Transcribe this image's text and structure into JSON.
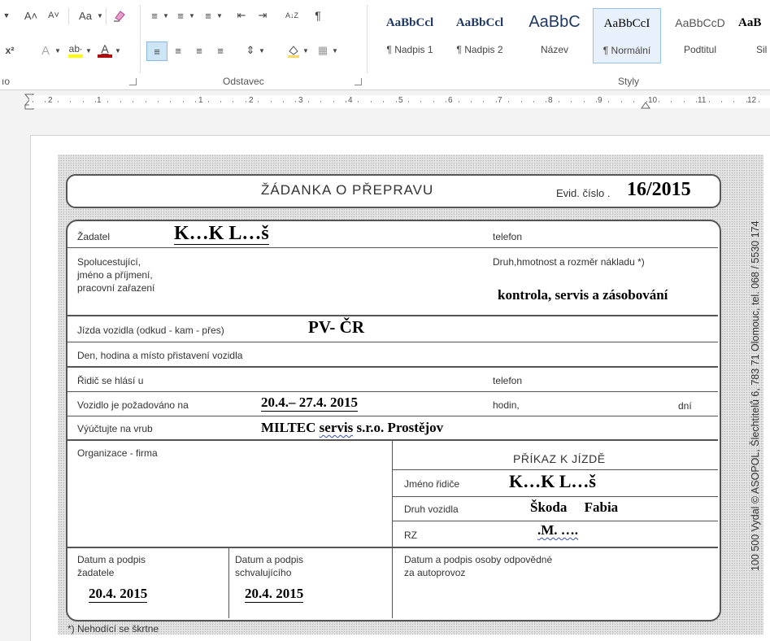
{
  "ribbon": {
    "font": {
      "grow_icon": "A˄",
      "shrink_icon": "A˅",
      "case_label": "Aa",
      "clear_icon": "eraser-icon",
      "superscript": "x²",
      "effects_icon": "A",
      "highlight_icon": "ab∙",
      "color_icon": "A",
      "font_color": "#c00000",
      "highlight_color": "#ffff00",
      "left_label": "ıo"
    },
    "paragraph": {
      "group_label": "Odstavec",
      "sort_icon": "A↓Z",
      "pilcrow": "¶"
    },
    "styles": {
      "group_label": "Styly",
      "items": [
        {
          "sample": "AaBbCcl",
          "name": "¶ Nadpis 1"
        },
        {
          "sample": "AaBbCcl",
          "name": "¶ Nadpis 2"
        },
        {
          "sample": "AaBbC",
          "name": "Název"
        },
        {
          "sample": "AaBbCcI",
          "name": "¶ Normální"
        },
        {
          "sample": "AaBbCcD",
          "name": "Podtitul"
        },
        {
          "sample": "AaB",
          "name": "Sil"
        }
      ]
    }
  },
  "ruler": {
    "numbers": [
      "2",
      "1",
      "1",
      "2",
      "3",
      "4",
      "5",
      "6",
      "7",
      "8",
      "9",
      "10",
      "11",
      "12"
    ]
  },
  "form": {
    "title": "ŽÁDANKA O PŘEPRAVU",
    "evid_label": "Evid. číslo .",
    "evid_value": "16/2015",
    "zadatel_label": "Žadatel",
    "zadatel_value": "K…K L…š",
    "telefon_label": "telefon",
    "spolucestujici_line1": "Spolucestující,",
    "spolucestujici_line2": "jméno a příjmení,",
    "spolucestujici_line3": "pracovní zařazení",
    "druh_label": "Druh,hmotnost a rozměr nákladu *)",
    "druh_value": "kontrola, servis a zásobování",
    "jizda_label": "Jízda vozidla (odkud - kam - přes)",
    "jizda_value": "PV- ČR",
    "den_label": "Den, hodina a místo přistavení vozidla",
    "ridic_label": "Řidič se hlásí u",
    "telefon2_label": "telefon",
    "vozidlo_label": "Vozidlo je požadováno na",
    "vozidlo_value": "20.4.– 27.4. 2015",
    "hodin_label": "hodin,",
    "dni_label": "dní",
    "vyuctujte_label": "Výúčtujte na vrub",
    "vyuctujte_value_a": "MILTEC ",
    "vyuctujte_value_b": "servis",
    "vyuctujte_value_c": " s.r.o.  Prostějov",
    "organizace_label": "Organizace - firma",
    "prikaz_label": "PŘÍKAZ K JÍZDĚ",
    "jmeno_ridice_label": "Jméno řidiče",
    "jmeno_ridice_value": "K…K L…š",
    "druh_vozidla_label": "Druh vozidla",
    "druh_vozidla_value": "Škoda     Fabia",
    "rz_label": "RZ",
    "rz_value": ".M. ….",
    "datum_zadatele_line1": "Datum a podpis",
    "datum_zadatele_line2": "žadatele",
    "datum_zadatele_value": "20.4. 2015",
    "datum_schval_line1": "Datum a podpis",
    "datum_schval_line2": "schvalujícího",
    "datum_schval_value": "20.4. 2015",
    "datum_osoby_line1": "Datum a podpis osoby odpovědné",
    "datum_osoby_line2": "za autoprovoz",
    "footnote": "*) Nehodící se škrtne",
    "side_text": "100 500 Vydal © ASOPOL, Šlechtitelů 6, 783 71 Olomouc, tel. 068 / 5530 174"
  }
}
